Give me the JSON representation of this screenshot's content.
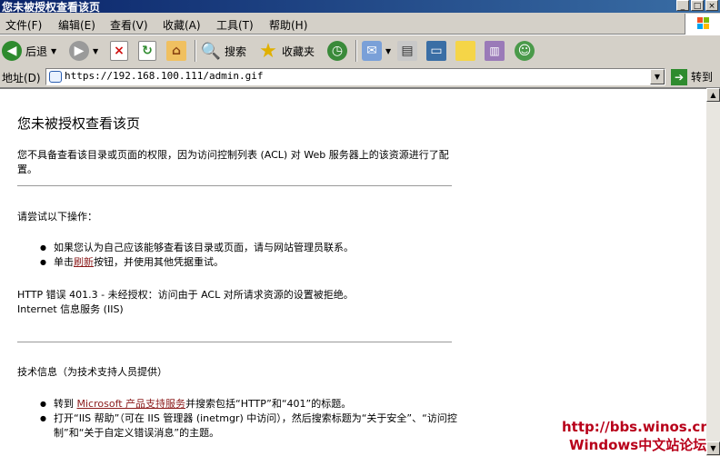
{
  "window": {
    "title": "您未被授权查看该页"
  },
  "menu": [
    "文件(F)",
    "编辑(E)",
    "查看(V)",
    "收藏(A)",
    "工具(T)",
    "帮助(H)"
  ],
  "toolbar": {
    "back": "后退",
    "search": "搜索",
    "favorites": "收藏夹"
  },
  "address": {
    "label": "地址(D)",
    "url": "https://192.168.100.111/admin.gif",
    "go": "转到"
  },
  "page": {
    "title": "您未被授权查看该页",
    "intro": "您不具备查看该目录或页面的权限，因为访问控制列表 (ACL) 对 Web 服务器上的该资源进行了配置。",
    "try_heading": "请尝试以下操作：",
    "try_items": [
      "如果您认为自己应该能够查看该目录或页面，请与网站管理员联系。"
    ],
    "refresh_pre": "单击",
    "refresh_link": "刷新",
    "refresh_post": "按钮，并使用其他凭据重试。",
    "error_line1": "HTTP 错误 401.3 - 未经授权：访问由于 ACL 对所请求资源的设置被拒绝。",
    "error_line2": "Internet 信息服务 (IIS)",
    "tech_heading": "技术信息（为技术支持人员提供）",
    "tech1_pre": "转到",
    "tech1_link": "Microsoft 产品支持服务",
    "tech1_post": "并搜索包括“HTTP”和“401”的标题。",
    "tech2": "打开“IIS 帮助”（可在 IIS 管理器 (inetmgr) 中访问），然后搜索标题为“关于安全”、“访问控制”和“关于自定义错误消息”的主题。"
  },
  "watermark": {
    "line1": "http://bbs.winos.cn",
    "line2": "Windows中文站论坛"
  },
  "colors": {
    "titlebar": "#0a246a",
    "link": "#8b1a1a",
    "chrome": "#d4d0c8",
    "watermark": "#b8001a"
  }
}
